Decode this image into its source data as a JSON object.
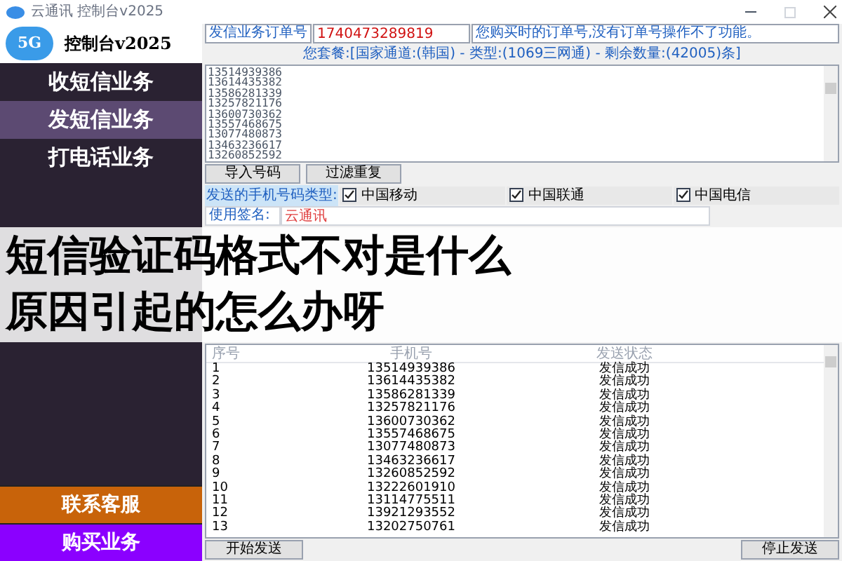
{
  "window": {
    "title": "云通讯 控制台v2025"
  },
  "logo": {
    "badge": "5G",
    "title": "控制台v2025"
  },
  "sidebar": {
    "items": [
      {
        "label": "收短信业务",
        "selected": false
      },
      {
        "label": "发短信业务",
        "selected": true
      },
      {
        "label": "打电话业务",
        "selected": false
      }
    ],
    "bottom_items": [
      {
        "label": "联系客服",
        "color": "#c8630a"
      },
      {
        "label": "购买业务",
        "color": "#8b00ff"
      }
    ]
  },
  "order": {
    "label": "发信业务订单号",
    "value": "1740473289819",
    "hint": "您购买时的订单号,没有订单号操作不了功能。"
  },
  "package_line": "您套餐:[国家通道:(韩国) - 类型:(1069三网通) - 剩余数量:(42005)条]",
  "numbers": [
    "13514939386",
    "13614435382",
    "13586281339",
    "13257821176",
    "13600730362",
    "13557468675",
    "13077480873",
    "13463236617",
    "13260852592"
  ],
  "buttons": [
    "导入号码",
    "过滤重复"
  ],
  "carrier_label": "发送的手机号码类型:",
  "carriers": [
    {
      "label": "中国移动",
      "checked": true
    },
    {
      "label": "中国联通",
      "checked": true
    },
    {
      "label": "中国电信",
      "checked": true
    }
  ],
  "signature": {
    "label": "使用签名:",
    "value": "云通讯"
  },
  "table": {
    "columns": [
      "序号",
      "手机号",
      "发送状态"
    ],
    "rows": [
      [
        "1",
        "13514939386",
        "发信成功"
      ],
      [
        "2",
        "13614435382",
        "发信成功"
      ],
      [
        "3",
        "13586281339",
        "发信成功"
      ],
      [
        "4",
        "13257821176",
        "发信成功"
      ],
      [
        "5",
        "13600730362",
        "发信成功"
      ],
      [
        "6",
        "13557468675",
        "发信成功"
      ],
      [
        "7",
        "13077480873",
        "发信成功"
      ],
      [
        "8",
        "13463236617",
        "发信成功"
      ],
      [
        "9",
        "13260852592",
        "发信成功"
      ],
      [
        "10",
        "13222601910",
        "发信成功"
      ],
      [
        "11",
        "13114775511",
        "发信成功"
      ],
      [
        "12",
        "13921293552",
        "发信成功"
      ],
      [
        "13",
        "13202750761",
        "发信成功"
      ]
    ]
  },
  "actions": [
    "开始发送",
    "停止发送"
  ],
  "banner": {
    "lines": [
      "短信验证码格式不对是什么",
      "原因引起的怎么办呀"
    ]
  }
}
